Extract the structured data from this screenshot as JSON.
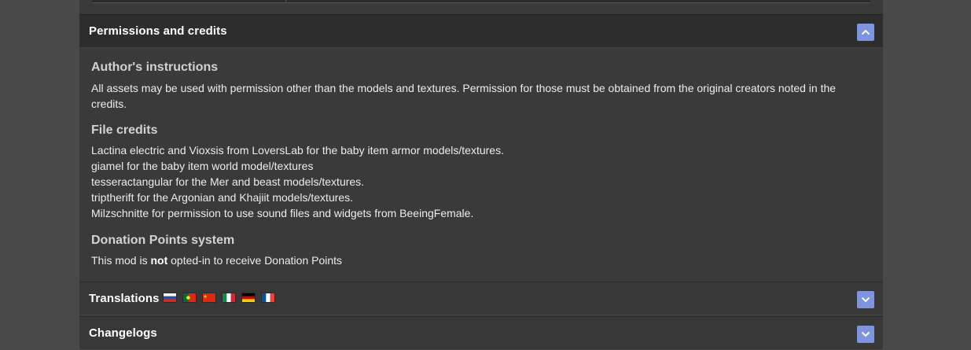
{
  "sections": {
    "permissions": {
      "title": "Permissions and credits",
      "expanded": true,
      "toggle_icon": "chevron-up-icon",
      "authors_instructions": {
        "heading": "Author's instructions",
        "text": "All assets may be used with permission other than the models and textures. Permission for those must be obtained from the original creators noted in the credits."
      },
      "file_credits": {
        "heading": "File credits",
        "lines": [
          "Lactina electric and Vioxsis from LoversLab for the baby item armor models/textures.",
          "giamel for the baby item world model/textures",
          "tesseractangular for the Mer and beast models/textures.",
          "triptherift for the Argonian and Khajiit models/textures.",
          "Milzschnitte for permission to use sound files and widgets from BeeingFemale."
        ]
      },
      "donation": {
        "heading": "Donation Points system",
        "text_before": "This mod is ",
        "text_bold": "not",
        "text_after": " opted-in to receive Donation Points"
      }
    },
    "translations": {
      "title": "Translations",
      "expanded": false,
      "toggle_icon": "chevron-down-icon",
      "flags": [
        "russia-flag-icon",
        "portugal-flag-icon",
        "china-flag-icon",
        "italy-flag-icon",
        "germany-flag-icon",
        "france-flag-icon"
      ]
    },
    "changelogs": {
      "title": "Changelogs",
      "expanded": false,
      "toggle_icon": "chevron-down-icon"
    }
  },
  "colors": {
    "toggle_button": "#7f94e0",
    "header_bg": "#2d2d2d",
    "panel_bg": "#3a3a3a",
    "outer_bg": "#494949"
  }
}
